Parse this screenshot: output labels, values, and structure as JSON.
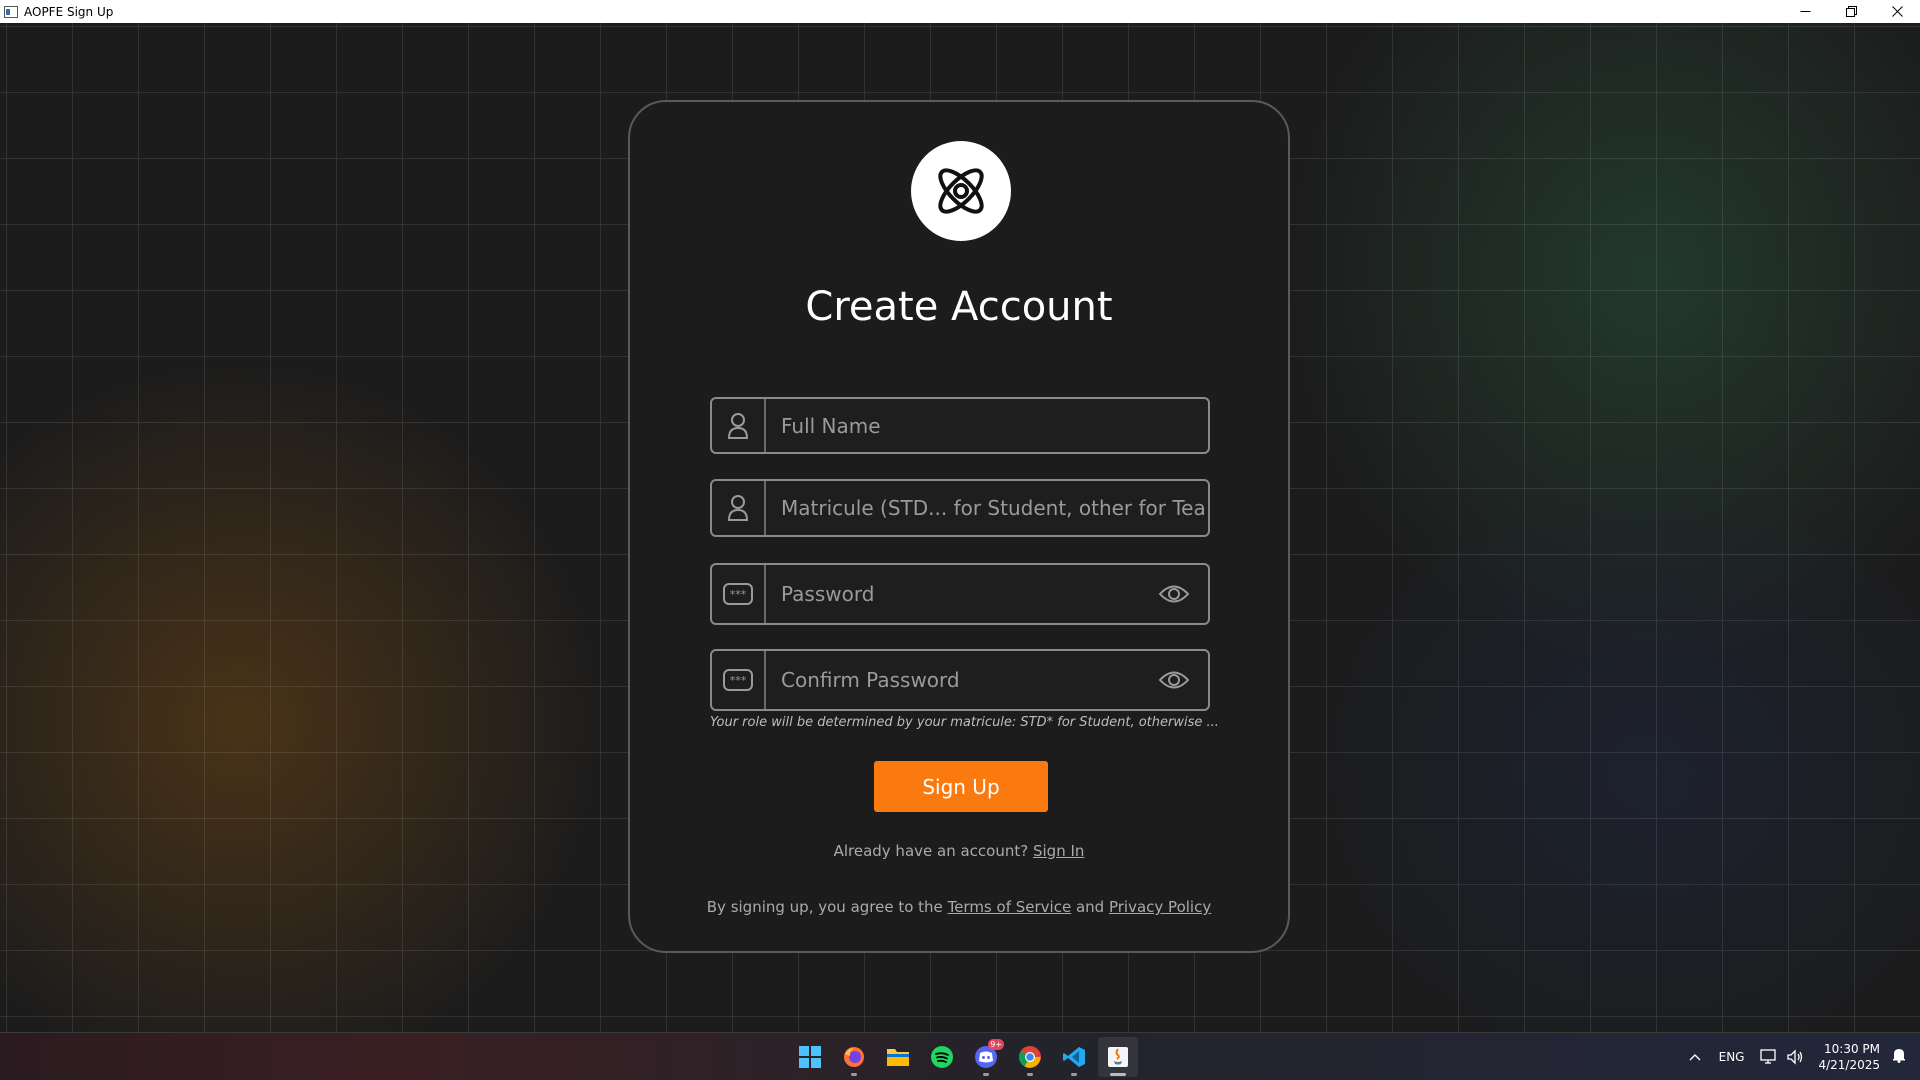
{
  "window": {
    "title": "AOPFE Sign Up"
  },
  "form": {
    "heading": "Create Account",
    "fields": {
      "full_name": {
        "placeholder": "Full Name",
        "icon": "user-icon"
      },
      "matricule": {
        "placeholder": "Matricule (STD... for Student, other for Teacher)",
        "icon": "user-icon"
      },
      "password": {
        "placeholder": "Password",
        "icon": "password-icon"
      },
      "confirm_password": {
        "placeholder": "Confirm Password",
        "icon": "password-icon"
      }
    },
    "role_note": "Your role will be determined by your matricule: STD* for Student, otherwise ...",
    "signup_label": "Sign Up",
    "signin_prompt": "Already have an account?",
    "signin_link": "Sign In",
    "terms_prefix": "By signing up, you agree to the",
    "terms_link": "Terms of Service",
    "terms_and": "and",
    "privacy_link": "Privacy Policy"
  },
  "taskbar": {
    "apps": [
      "start-icon",
      "firefox-icon",
      "file-explorer-icon",
      "spotify-icon",
      "discord-icon",
      "chrome-icon",
      "vscode-icon",
      "java-app-icon"
    ],
    "discord_badge": "9+",
    "language": "ENG",
    "time": "10:30 PM",
    "date": "4/21/2025"
  },
  "colors": {
    "accent": "#fb7a10",
    "card_bg": "#1c1c1c",
    "card_border": "#5a5a5a",
    "field_border": "#8a8a8a"
  }
}
